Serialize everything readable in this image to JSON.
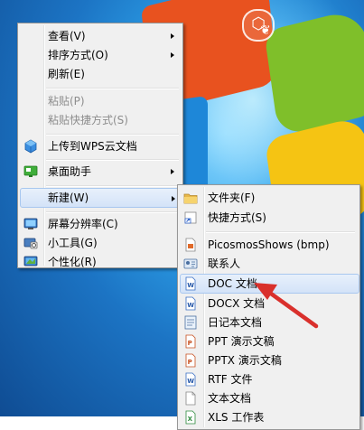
{
  "context_menu": {
    "items": [
      {
        "label": "查看(V)"
      },
      {
        "label": "排序方式(O)"
      },
      {
        "label": "刷新(E)"
      },
      {
        "label": "粘贴(P)"
      },
      {
        "label": "粘贴快捷方式(S)"
      },
      {
        "label": "上传到WPS云文档"
      },
      {
        "label": "桌面助手"
      },
      {
        "label": "新建(W)"
      },
      {
        "label": "屏幕分辨率(C)"
      },
      {
        "label": "小工具(G)"
      },
      {
        "label": "个性化(R)"
      }
    ]
  },
  "new_submenu": {
    "items": [
      {
        "label": "文件夹(F)"
      },
      {
        "label": "快捷方式(S)"
      },
      {
        "label": "PicosmosShows (bmp)"
      },
      {
        "label": "联系人"
      },
      {
        "label": "DOC 文档"
      },
      {
        "label": "DOCX 文档"
      },
      {
        "label": "日记本文档"
      },
      {
        "label": "PPT 演示文稿"
      },
      {
        "label": "PPTX 演示文稿"
      },
      {
        "label": "RTF 文件"
      },
      {
        "label": "文本文档"
      },
      {
        "label": "XLS 工作表"
      }
    ]
  },
  "colors": {
    "menu_bg": "#f0f0f0",
    "highlight": "#d4e3f8",
    "annotation_arrow": "#d9302c"
  }
}
